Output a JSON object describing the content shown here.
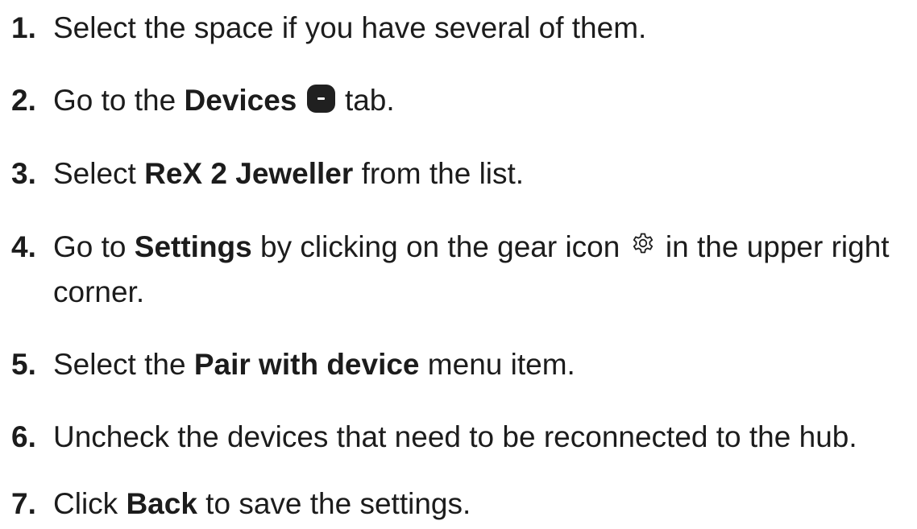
{
  "steps": [
    {
      "num": "1.",
      "t1": "Select the space if you have several of them."
    },
    {
      "num": "2.",
      "t1": "Go to the ",
      "b1": "Devices",
      "t2": " tab.",
      "icon": "devices-tab-icon"
    },
    {
      "num": "3.",
      "t1": "Select ",
      "b1": "ReX 2 Jeweller",
      "t2": " from the list."
    },
    {
      "num": "4.",
      "t1": "Go to ",
      "b1": "Settings",
      "t2": " by clicking on the gear icon ",
      "t3": " in the upper right",
      "t4": "corner.",
      "icon": "gear-icon"
    },
    {
      "num": "5.",
      "t1": "Select the ",
      "b1": "Pair with device",
      "t2": " menu item."
    },
    {
      "num": "6.",
      "t1": "Uncheck the devices that need to be reconnected to the hub."
    },
    {
      "num": "7.",
      "t1": "Click ",
      "b1": "Back",
      "t2": " to save the settings."
    }
  ]
}
